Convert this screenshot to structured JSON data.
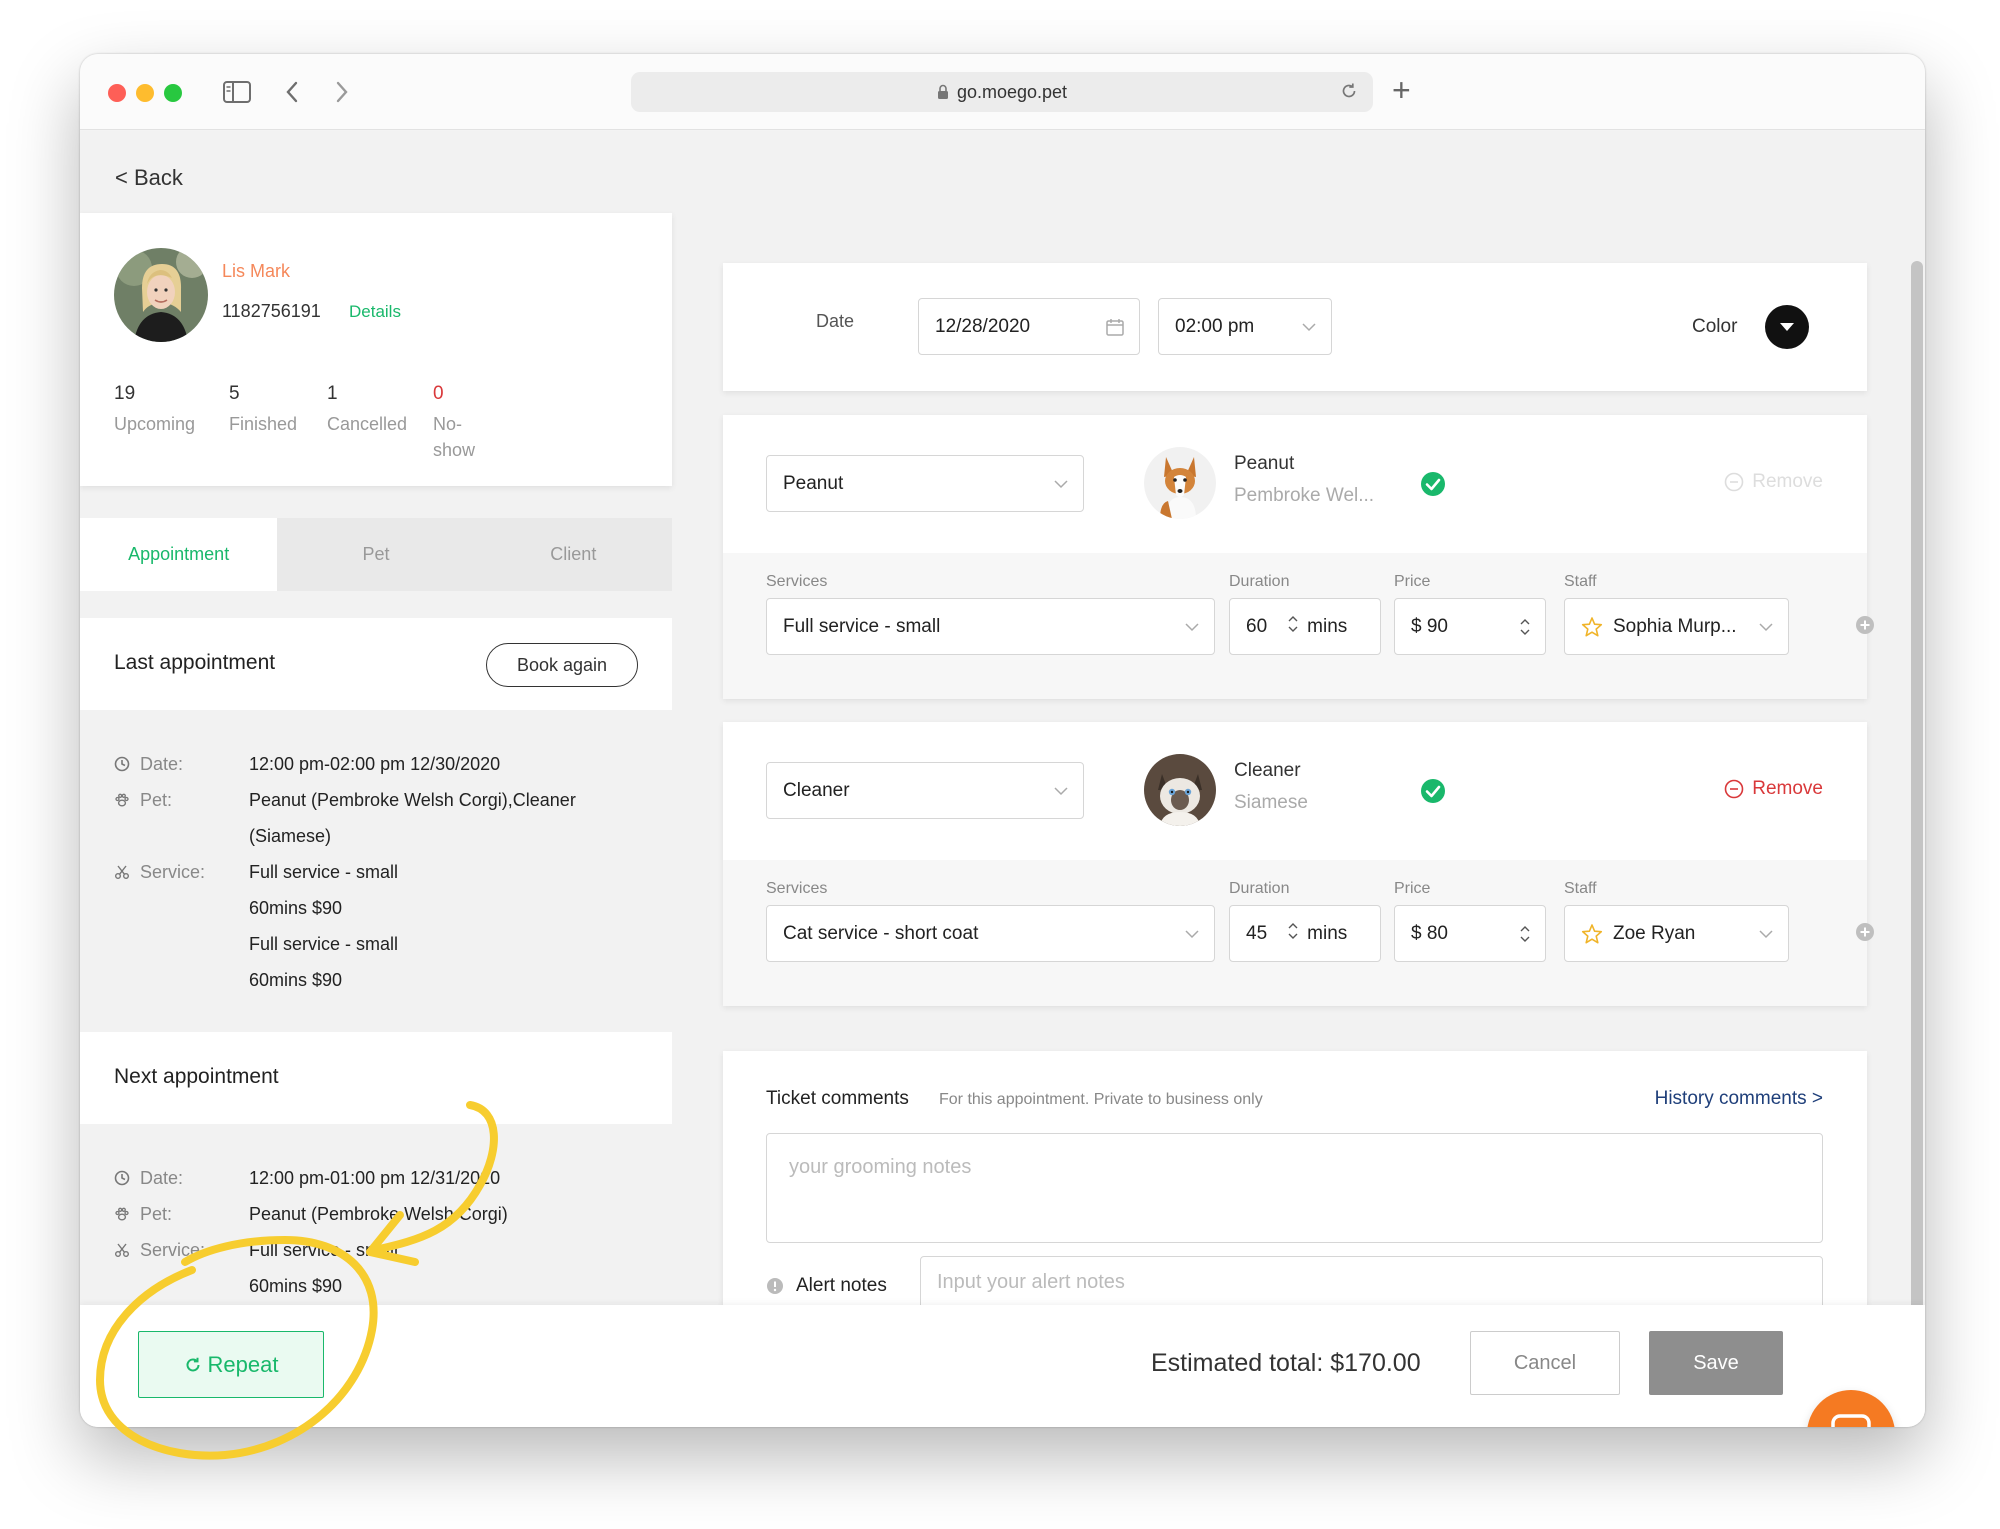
{
  "browser": {
    "url": "go.moego.pet"
  },
  "nav": {
    "back_label": "< Back"
  },
  "client": {
    "name": "Lis Mark",
    "phone": "1182756191",
    "details_label": "Details",
    "stats": [
      {
        "value": "19",
        "label": "Upcoming"
      },
      {
        "value": "5",
        "label": "Finished"
      },
      {
        "value": "1",
        "label": "Cancelled"
      },
      {
        "value": "0",
        "label": "No-show"
      }
    ]
  },
  "tabs": [
    {
      "label": "Appointment",
      "active": true
    },
    {
      "label": "Pet",
      "active": false
    },
    {
      "label": "Client",
      "active": false
    }
  ],
  "last_appointment": {
    "title": "Last appointment",
    "book_again_label": "Book again",
    "date_key": "Date:",
    "date_value": "12:00 pm-02:00 pm 12/30/2020",
    "pet_key": "Pet:",
    "pet_value_1": "Peanut (Pembroke Welsh Corgi),Cleaner",
    "pet_value_2": "(Siamese)",
    "service_key": "Service:",
    "service_lines": [
      "Full service - small",
      "60mins  $90",
      "Full service - small",
      "60mins  $90"
    ]
  },
  "next_appointment": {
    "title": "Next appointment",
    "date_key": "Date:",
    "date_value": "12:00 pm-01:00 pm 12/31/2020",
    "pet_key": "Pet:",
    "pet_value": "Peanut (Pembroke Welsh Corgi)",
    "service_key": "Service:",
    "service_lines": [
      "Full service - small",
      "60mins  $90"
    ]
  },
  "schedule": {
    "date_label": "Date",
    "date_value": "12/28/2020",
    "time_value": "02:00 pm",
    "color_label": "Color"
  },
  "pets": [
    {
      "select_value": "Peanut",
      "name": "Peanut",
      "breed": "Pembroke Wel...",
      "remove_label": "Remove",
      "remove_enabled": false,
      "services_label": "Services",
      "duration_label": "Duration",
      "price_label": "Price",
      "staff_label": "Staff",
      "service_value": "Full service - small",
      "duration_value": "60",
      "duration_unit": "mins",
      "price_value": "$ 90",
      "staff_value": "Sophia Murp..."
    },
    {
      "select_value": "Cleaner",
      "name": "Cleaner",
      "breed": "Siamese",
      "remove_label": "Remove",
      "remove_enabled": true,
      "services_label": "Services",
      "duration_label": "Duration",
      "price_label": "Price",
      "staff_label": "Staff",
      "service_value": "Cat service - short coat",
      "duration_value": "45",
      "duration_unit": "mins",
      "price_value": "$ 80",
      "staff_value": "Zoe Ryan"
    }
  ],
  "comments": {
    "title": "Ticket comments",
    "subtitle": "For this appointment. Private to business only",
    "history_label": "History comments >",
    "ticket_placeholder": "your grooming notes",
    "alert_label": "Alert notes",
    "alert_placeholder": "Input your alert notes"
  },
  "footer": {
    "repeat_label": "Repeat",
    "estimated_total": "Estimated total: $170.00",
    "cancel_label": "Cancel",
    "save_label": "Save"
  },
  "colors": {
    "brand_green": "#19b86b",
    "client_name": "#f5885a",
    "danger": "#d9383a",
    "chat_orange": "#f57a22",
    "annotation_yellow": "#f7cd2f"
  }
}
